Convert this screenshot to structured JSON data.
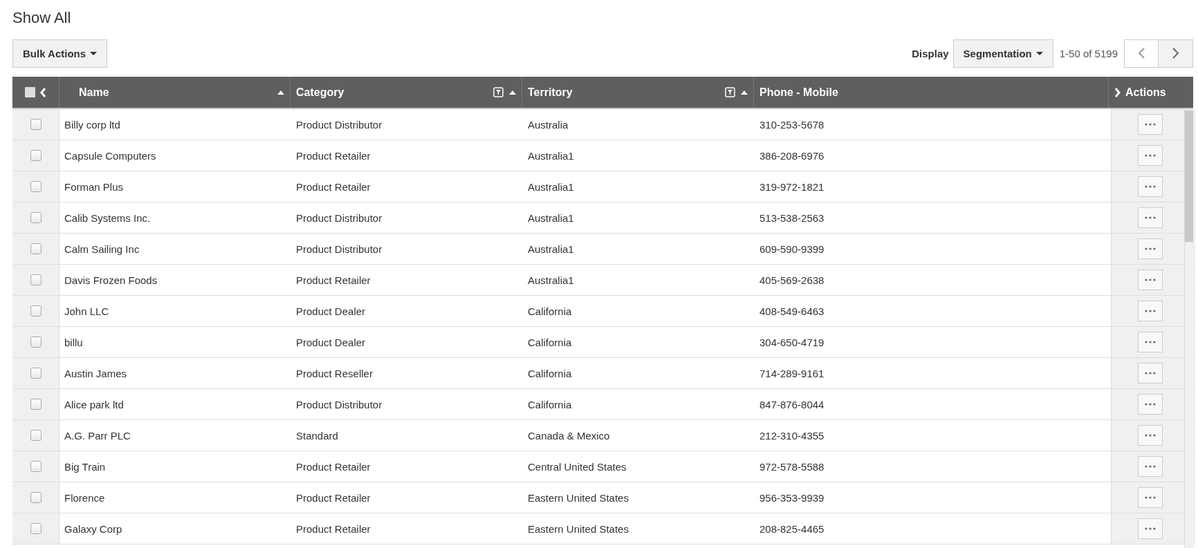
{
  "title": "Show All",
  "bulk_actions": {
    "label": "Bulk Actions"
  },
  "display": {
    "label": "Display",
    "value": "Segmentation"
  },
  "pagination": {
    "range": "1-50 of 5199"
  },
  "table": {
    "select_all": {
      "checked": false
    },
    "columns": [
      {
        "label": "Name",
        "filter": false,
        "sorted": true
      },
      {
        "label": "Category",
        "filter": true,
        "sorted": true
      },
      {
        "label": "Territory",
        "filter": true,
        "sorted": true
      },
      {
        "label": "Phone - Mobile",
        "filter": false,
        "sorted": false
      }
    ],
    "actions_column": "Actions",
    "rows": [
      {
        "checked": false,
        "cells": [
          "Billy corp ltd",
          "Product Distributor",
          "Australia",
          "310-253-5678"
        ]
      },
      {
        "checked": false,
        "cells": [
          "Capsule Computers",
          "Product Retailer",
          "Australia1",
          "386-208-6976"
        ]
      },
      {
        "checked": false,
        "cells": [
          "Forman Plus",
          "Product Retailer",
          "Australia1",
          "319-972-1821"
        ]
      },
      {
        "checked": false,
        "cells": [
          "Calib Systems Inc.",
          "Product Distributor",
          "Australia1",
          "513-538-2563"
        ]
      },
      {
        "checked": false,
        "cells": [
          "Calm Sailing Inc",
          "Product Distributor",
          "Australia1",
          "609-590-9399"
        ]
      },
      {
        "checked": false,
        "cells": [
          "Davis Frozen Foods",
          "Product Retailer",
          "Australia1",
          "405-569-2638"
        ]
      },
      {
        "checked": false,
        "cells": [
          "John LLC",
          "Product Dealer",
          "California",
          "408-549-6463"
        ]
      },
      {
        "checked": false,
        "cells": [
          "billu",
          "Product Dealer",
          "California",
          "304-650-4719"
        ]
      },
      {
        "checked": false,
        "cells": [
          "Austin James",
          "Product Reseller",
          "California",
          "714-289-9161"
        ]
      },
      {
        "checked": false,
        "cells": [
          "Alice park ltd",
          "Product Distributor",
          "California",
          "847-876-8044"
        ]
      },
      {
        "checked": false,
        "cells": [
          "A.G. Parr PLC",
          "Standard",
          "Canada & Mexico",
          "212-310-4355"
        ]
      },
      {
        "checked": false,
        "cells": [
          "Big Train",
          "Product Retailer",
          "Central United States",
          "972-578-5588"
        ]
      },
      {
        "checked": false,
        "cells": [
          "Florence",
          "Product Retailer",
          "Eastern United States",
          "956-353-9939"
        ]
      },
      {
        "checked": false,
        "cells": [
          "Galaxy Corp",
          "Product Retailer",
          "Eastern United States",
          "208-825-4465"
        ]
      }
    ]
  }
}
